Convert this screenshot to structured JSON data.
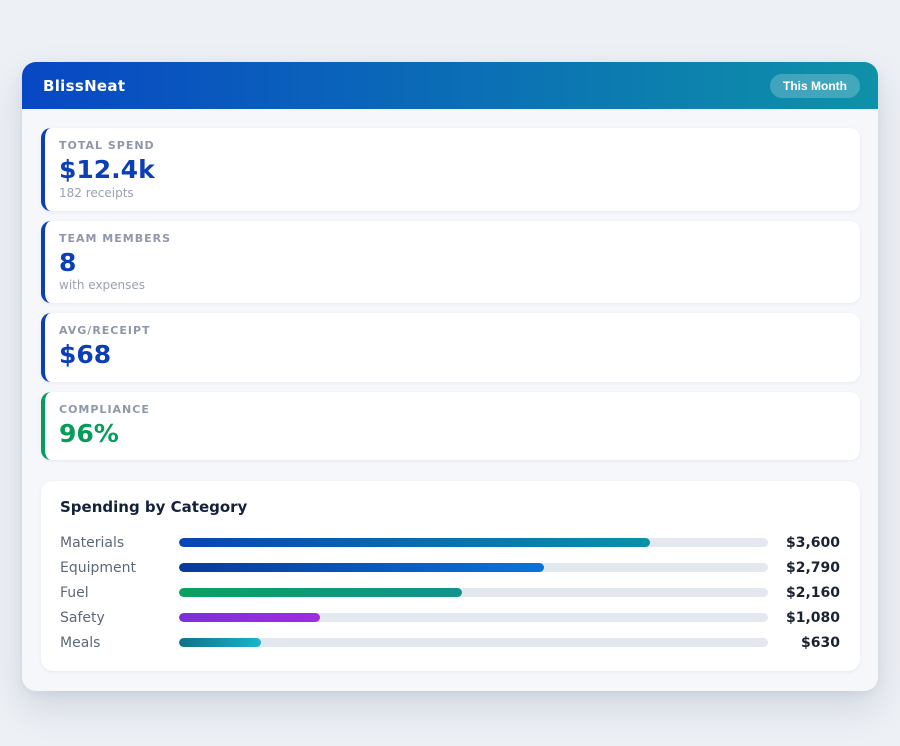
{
  "header": {
    "brand": "BlissNeat",
    "period_badge": "This Month",
    "gradient_from": "#0847c4",
    "gradient_to": "#0e92a8"
  },
  "stats": [
    {
      "label": "TOTAL SPEND",
      "value": "$12.4k",
      "sublabel": "182 receipts",
      "accent": "#0c3eb8"
    },
    {
      "label": "TEAM MEMBERS",
      "value": "8",
      "sublabel": "with expenses",
      "accent": "#0c3eb8"
    },
    {
      "label": "AVG/RECEIPT",
      "value": "$68",
      "sublabel": "",
      "accent": "#0c3eb8"
    },
    {
      "label": "COMPLIANCE",
      "value": "96%",
      "sublabel": "",
      "accent": "#069c5c"
    }
  ],
  "chart_data": {
    "type": "bar",
    "orientation": "horizontal",
    "title": "Spending by Category",
    "categories": [
      "Materials",
      "Equipment",
      "Fuel",
      "Safety",
      "Meals"
    ],
    "values": [
      3600,
      2790,
      2160,
      1080,
      630
    ],
    "value_labels": [
      "$3,600",
      "$2,790",
      "$2,160",
      "$1,080",
      "$630"
    ],
    "axis_max": 4500,
    "bar_percents": [
      80,
      62,
      48,
      24,
      14
    ],
    "grid": false,
    "legend": false,
    "track_color": "#e3e8ef",
    "bar_colors": [
      {
        "from": "#0845b5",
        "to": "#0892a8"
      },
      {
        "from": "#083a9a",
        "to": "#0a73da"
      },
      {
        "from": "#0aa161",
        "to": "#12938c"
      },
      {
        "from": "#7c30d8",
        "to": "#9f2ce2"
      },
      {
        "from": "#0f7187",
        "to": "#16b6cc"
      }
    ]
  }
}
